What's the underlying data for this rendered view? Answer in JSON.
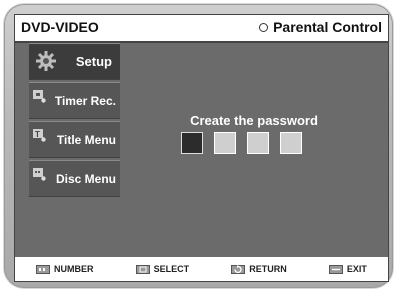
{
  "header": {
    "title": "DVD-VIDEO",
    "mode": "Parental Control"
  },
  "menu": {
    "items": [
      {
        "label": "Setup",
        "icon": "gear-icon",
        "active": true
      },
      {
        "label": "Timer Rec.",
        "icon": "timer-rec-icon",
        "active": false
      },
      {
        "label": "Title Menu",
        "icon": "title-menu-icon",
        "active": false
      },
      {
        "label": "Disc Menu",
        "icon": "disc-menu-icon",
        "active": false
      }
    ]
  },
  "main": {
    "prompt": "Create the password",
    "password": {
      "length": 4,
      "entered": 1
    }
  },
  "footer": {
    "number": "NUMBER",
    "select": "SELECT",
    "return": "RETURN",
    "exit": "EXIT"
  }
}
